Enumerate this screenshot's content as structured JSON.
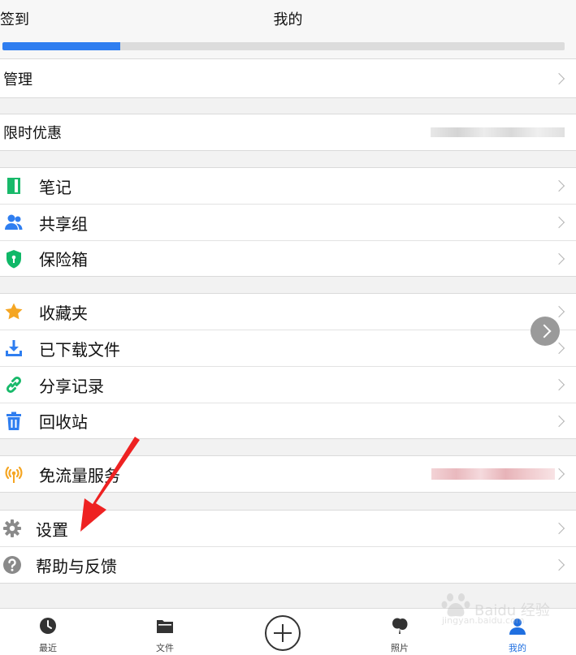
{
  "header": {
    "left": "签到",
    "title": "我的"
  },
  "storage": {
    "used_fraction": 0.21
  },
  "manage": {
    "label": "管理"
  },
  "promo": {
    "label": "限时优惠"
  },
  "group1": [
    {
      "label": "笔记",
      "icon": "notebook-icon",
      "color": "#18b96a"
    },
    {
      "label": "共享组",
      "icon": "users-icon",
      "color": "#2f7ef0"
    },
    {
      "label": "保险箱",
      "icon": "shield-icon",
      "color": "#10b868"
    }
  ],
  "group2": [
    {
      "label": "收藏夹",
      "icon": "star-icon",
      "color": "#f5a623"
    },
    {
      "label": "已下载文件",
      "icon": "download-icon",
      "color": "#2f7ef0"
    },
    {
      "label": "分享记录",
      "icon": "link-icon",
      "color": "#18b96a"
    },
    {
      "label": "回收站",
      "icon": "trash-icon",
      "color": "#2f7ef0"
    }
  ],
  "free_traffic": {
    "label": "免流量服务",
    "icon": "signal-icon",
    "color": "#f5a623"
  },
  "group4": [
    {
      "label": "设置",
      "icon": "gear-icon",
      "color": "#8a8a8a"
    },
    {
      "label": "帮助与反馈",
      "icon": "help-icon",
      "color": "#8a8a8a"
    }
  ],
  "annotation": {
    "color": "#ee2222"
  },
  "tabs": [
    {
      "label": "最近",
      "icon": "clock-icon"
    },
    {
      "label": "文件",
      "icon": "folder-icon"
    },
    {
      "label": "",
      "icon": "add-icon"
    },
    {
      "label": "照片",
      "icon": "photo-balloon-icon"
    },
    {
      "label": "我的",
      "icon": "person-icon",
      "active": true
    }
  ],
  "watermark": {
    "text": "Baidu 经验",
    "sub": "jingyan.baidu.com"
  }
}
